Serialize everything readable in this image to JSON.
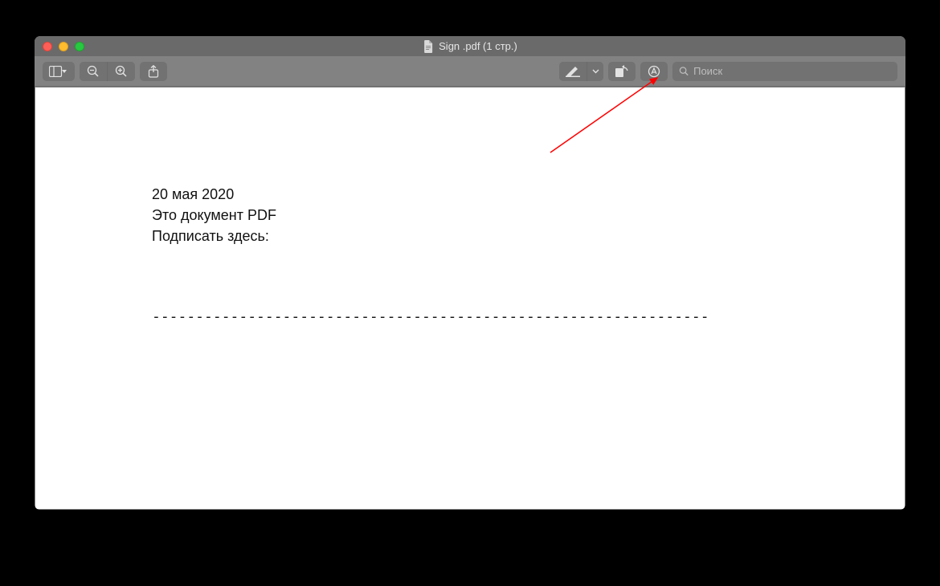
{
  "window": {
    "title": "Sign .pdf (1 стр.)"
  },
  "toolbar": {
    "search_placeholder": "Поиск"
  },
  "document": {
    "line1": "20 мая 2020",
    "line2": "Это документ PDF",
    "line3": "Подписать здесь:",
    "separator": "----------------------------------------------------------------"
  },
  "colors": {
    "annotation_arrow": "#ff0000"
  }
}
